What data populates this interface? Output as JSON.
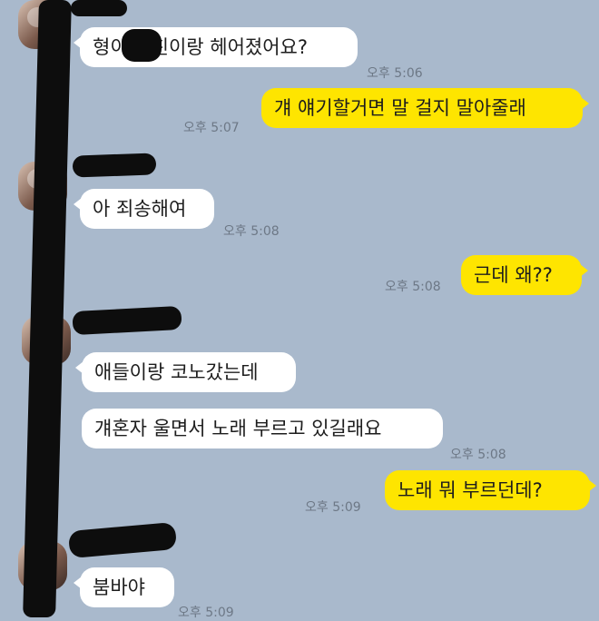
{
  "messages": [
    {
      "side": "in",
      "text": "형이 여친이랑 헤어졌어요?",
      "time": "오후 5:06"
    },
    {
      "side": "out",
      "text": "걔 얘기할거면 말 걸지 말아줄래",
      "time": "오후 5:07"
    },
    {
      "side": "in",
      "text": "아 죄송해여",
      "time": "오후 5:08"
    },
    {
      "side": "out",
      "text": "근데 왜??",
      "time": "오후 5:08"
    },
    {
      "side": "in",
      "text": "애들이랑 코노갔는데",
      "time": ""
    },
    {
      "side": "in",
      "text": "걔혼자 울면서 노래 부르고 있길래요",
      "time": "오후 5:08"
    },
    {
      "side": "out",
      "text": "노래 뭐 부르던데?",
      "time": "오후 5:09"
    },
    {
      "side": "in",
      "text": "붐바야",
      "time": "오후 5:09"
    }
  ],
  "colors": {
    "background": "#a9b9cc",
    "incoming_bubble": "#ffffff",
    "outgoing_bubble": "#fee500",
    "redaction": "#0d0d0d"
  }
}
